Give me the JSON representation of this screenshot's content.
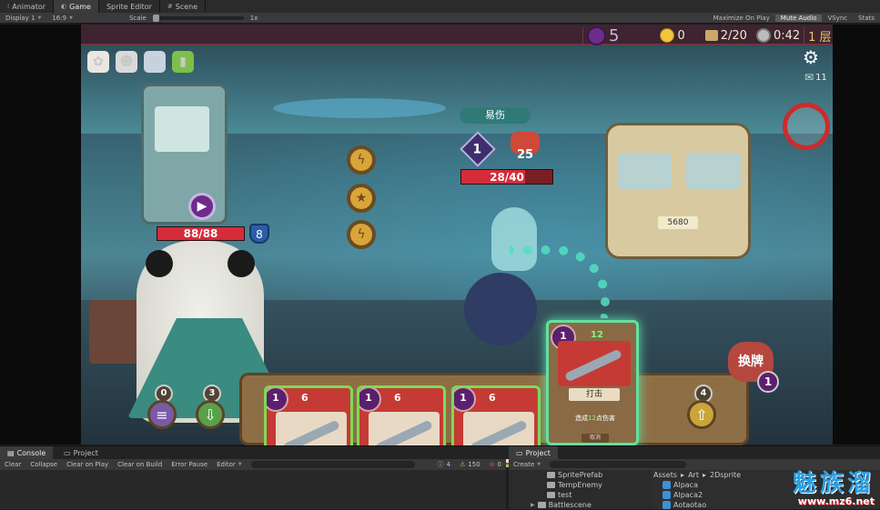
{
  "editor_tabs": [
    {
      "label": "Animator",
      "icon": "animator-icon"
    },
    {
      "label": "Game",
      "icon": "game-icon",
      "active": true
    },
    {
      "label": "Sprite Editor",
      "icon": ""
    },
    {
      "label": "Scene",
      "icon": "scene-icon"
    }
  ],
  "game_toolbar": {
    "display": "Display 1",
    "aspect": "16:9",
    "scale_label": "Scale",
    "scale_value": "1x",
    "maximize": "Maximize On Play",
    "mute": "Mute Audio",
    "vsync": "VSync",
    "stats": "Stats"
  },
  "hud": {
    "energy": "5",
    "gold": "0",
    "cards": "2/20",
    "time": "0:42",
    "floor": "1 层",
    "settings_count": "11"
  },
  "player": {
    "hp_text": "88/88",
    "hp_fraction": 1.0,
    "shield": "8"
  },
  "enemy": {
    "status": "易伤",
    "status_stacks": "1",
    "attack": "25",
    "hp_text": "28/40",
    "hp_fraction": 0.7
  },
  "hand": {
    "cards": [
      {
        "cost": "1",
        "value": "6"
      },
      {
        "cost": "1",
        "value": "6"
      },
      {
        "cost": "1",
        "value": "6"
      }
    ],
    "selected_card": {
      "cost": "1",
      "value": "12",
      "name": "打击",
      "desc_pre": "造成",
      "desc_num": "12",
      "desc_post": "点伤害",
      "cancel": "取消"
    },
    "discard_count": "0",
    "draw_count": "3",
    "exhaust_count": "4",
    "swap_label": "换牌",
    "swap_count": "1"
  },
  "console_panel": {
    "tabs": [
      "Console",
      "Project"
    ],
    "buttons": [
      "Clear",
      "Collapse",
      "Clear on Play",
      "Clear on Build",
      "Error Pause",
      "Editor"
    ],
    "info_count": "4",
    "warn_count": "150",
    "error_count": "0"
  },
  "project_panel": {
    "tab": "Project",
    "create": "Create",
    "tree": [
      "SpritePrefab",
      "TempEnemy",
      "test",
      "Battlescene"
    ],
    "breadcrumb": [
      "Assets",
      "Art",
      "2Dsprite"
    ],
    "files": [
      "Alpaca",
      "Alpaca2",
      "Aotaotao"
    ]
  },
  "watermark": {
    "big": "魅族溜",
    "small": "www.mz6.net"
  },
  "colors": {
    "hp_red": "#d62c3a",
    "card_green": "#7bdc55",
    "shield_blue": "#2a5ea8",
    "brand_blue": "#2a9ee4"
  }
}
